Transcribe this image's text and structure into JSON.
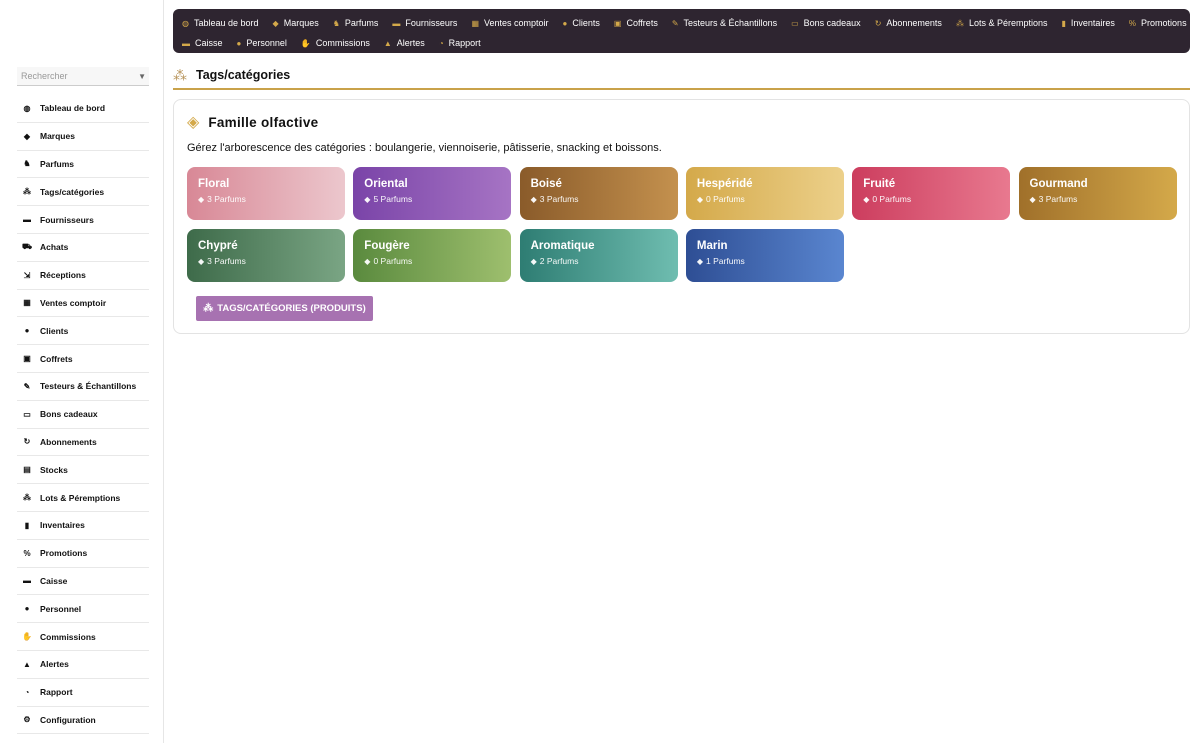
{
  "sidebar": {
    "search_placeholder": "Rechercher",
    "items": [
      {
        "label": "Tableau de bord",
        "icon": "dashboard-icon",
        "glyph": "◍"
      },
      {
        "label": "Marques",
        "icon": "gem-icon",
        "glyph": "◆"
      },
      {
        "label": "Parfums",
        "icon": "perfume-icon",
        "glyph": "♞"
      },
      {
        "label": "Tags/catégories",
        "icon": "sitemap-icon",
        "glyph": "⁂"
      },
      {
        "label": "Fournisseurs",
        "icon": "truck-icon",
        "glyph": "▬"
      },
      {
        "label": "Achats",
        "icon": "cart-icon",
        "glyph": "⛟"
      },
      {
        "label": "Réceptions",
        "icon": "cart-arrow-icon",
        "glyph": "⇲"
      },
      {
        "label": "Ventes comptoir",
        "icon": "store-icon",
        "glyph": "▦"
      },
      {
        "label": "Clients",
        "icon": "user-icon",
        "glyph": "●"
      },
      {
        "label": "Coffrets",
        "icon": "gift-icon",
        "glyph": "▣"
      },
      {
        "label": "Testeurs & Échantillons",
        "icon": "eyedropper-icon",
        "glyph": "✎"
      },
      {
        "label": "Bons cadeaux",
        "icon": "credit-card-icon",
        "glyph": "▭"
      },
      {
        "label": "Abonnements",
        "icon": "sync-icon",
        "glyph": "↻"
      },
      {
        "label": "Stocks",
        "icon": "warehouse-icon",
        "glyph": "▤"
      },
      {
        "label": "Lots & Péremptions",
        "icon": "boxes-icon",
        "glyph": "⁂"
      },
      {
        "label": "Inventaires",
        "icon": "clipboard-icon",
        "glyph": "▮"
      },
      {
        "label": "Promotions",
        "icon": "percent-icon",
        "glyph": "%"
      },
      {
        "label": "Caisse",
        "icon": "cash-icon",
        "glyph": "▬"
      },
      {
        "label": "Personnel",
        "icon": "users-icon",
        "glyph": "●"
      },
      {
        "label": "Commissions",
        "icon": "hand-coin-icon",
        "glyph": "✋"
      },
      {
        "label": "Alertes",
        "icon": "warning-icon",
        "glyph": "▲"
      },
      {
        "label": "Rapport",
        "icon": "pie-chart-icon",
        "glyph": "◔"
      },
      {
        "label": "Configuration",
        "icon": "gear-icon",
        "glyph": "⚙"
      }
    ]
  },
  "topnav": {
    "row1": [
      {
        "label": "Tableau de bord",
        "icon": "dashboard-icon",
        "glyph": "◍"
      },
      {
        "label": "Marques",
        "icon": "gem-icon",
        "glyph": "◆"
      },
      {
        "label": "Parfums",
        "icon": "perfume-icon",
        "glyph": "♞"
      },
      {
        "label": "Fournisseurs",
        "icon": "truck-icon",
        "glyph": "▬"
      },
      {
        "label": "Ventes comptoir",
        "icon": "store-icon",
        "glyph": "▦"
      },
      {
        "label": "Clients",
        "icon": "user-icon",
        "glyph": "●"
      },
      {
        "label": "Coffrets",
        "icon": "gift-icon",
        "glyph": "▣"
      },
      {
        "label": "Testeurs & Échantillons",
        "icon": "eyedropper-icon",
        "glyph": "✎"
      },
      {
        "label": "Bons cadeaux",
        "icon": "credit-card-icon",
        "glyph": "▭"
      },
      {
        "label": "Abonnements",
        "icon": "sync-icon",
        "glyph": "↻"
      },
      {
        "label": "Lots & Péremptions",
        "icon": "boxes-icon",
        "glyph": "⁂"
      },
      {
        "label": "Inventaires",
        "icon": "clipboard-icon",
        "glyph": "▮"
      },
      {
        "label": "Promotions",
        "icon": "percent-icon",
        "glyph": "%"
      }
    ],
    "row2": [
      {
        "label": "Caisse",
        "icon": "cash-icon",
        "glyph": "▬"
      },
      {
        "label": "Personnel",
        "icon": "users-icon",
        "glyph": "●"
      },
      {
        "label": "Commissions",
        "icon": "hand-coin-icon",
        "glyph": "✋"
      },
      {
        "label": "Alertes",
        "icon": "warning-icon",
        "glyph": "▲"
      },
      {
        "label": "Rapport",
        "icon": "pie-chart-icon",
        "glyph": "◔"
      }
    ]
  },
  "page": {
    "title": "Tags/catégories",
    "title_icon": "sitemap-icon"
  },
  "card": {
    "title": "Famille olfactive",
    "title_icon": "tags-icon",
    "description": "Gérez l'arborescence des catégories : boulangerie, viennoiserie, pâtisserie, snacking et boissons.",
    "count_icon": "gem-icon",
    "tiles": [
      {
        "name": "Floral",
        "count": "3 Parfums",
        "c1": "#d88896",
        "c2": "#ecc7cd"
      },
      {
        "name": "Oriental",
        "count": "5 Parfums",
        "c1": "#7a44a8",
        "c2": "#a674c4"
      },
      {
        "name": "Boisé",
        "count": "3 Parfums",
        "c1": "#8a5b2a",
        "c2": "#c4914e"
      },
      {
        "name": "Hespéridé",
        "count": "0 Parfums",
        "c1": "#d4a94a",
        "c2": "#ecd08a"
      },
      {
        "name": "Fruité",
        "count": "0 Parfums",
        "c1": "#cc3d5e",
        "c2": "#e8798f"
      },
      {
        "name": "Gourmand",
        "count": "3 Parfums",
        "c1": "#a0702a",
        "c2": "#d4a94a"
      },
      {
        "name": "Chypré",
        "count": "3 Parfums",
        "c1": "#3e6b4a",
        "c2": "#7aa584"
      },
      {
        "name": "Fougère",
        "count": "0 Parfums",
        "c1": "#5a8a3e",
        "c2": "#9ebf6e"
      },
      {
        "name": "Aromatique",
        "count": "2 Parfums",
        "c1": "#2e7d73",
        "c2": "#6fbdb0"
      },
      {
        "name": "Marin",
        "count": "1 Parfums",
        "c1": "#2e4e94",
        "c2": "#5a86d0"
      }
    ],
    "button_label": "TAGS/CATÉGORIES (PRODUITS)",
    "button_icon": "sitemap-icon"
  }
}
